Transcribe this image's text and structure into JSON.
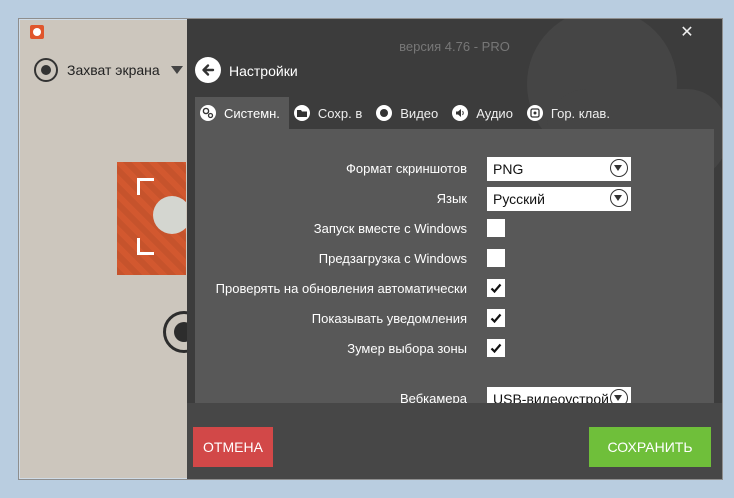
{
  "app": {
    "version": "версия 4.76 - PRO",
    "close_glyph": "✕"
  },
  "left": {
    "capture_mode": "Захват экрана"
  },
  "header": {
    "title": "Настройки"
  },
  "tabs": [
    {
      "label": "Системн.",
      "icon": "gears-icon",
      "active": true
    },
    {
      "label": "Сохр. в",
      "icon": "folder-icon",
      "active": false
    },
    {
      "label": "Видео",
      "icon": "record-icon",
      "active": false
    },
    {
      "label": "Аудио",
      "icon": "speaker-icon",
      "active": false
    },
    {
      "label": "Гор. клав.",
      "icon": "hotkey-icon",
      "active": false
    }
  ],
  "settings": {
    "screenshot_format": {
      "label": "Формат скриншотов",
      "value": "PNG"
    },
    "language": {
      "label": "Язык",
      "value": "Русский"
    },
    "start_with_windows": {
      "label": "Запуск вместе с Windows",
      "checked": false
    },
    "preload_with_windows": {
      "label": "Предзагрузка с Windows",
      "checked": false
    },
    "auto_update_check": {
      "label": "Проверять на обновления автоматически",
      "checked": true
    },
    "show_notifications": {
      "label": "Показывать уведомления",
      "checked": true
    },
    "zone_zoomer": {
      "label": "Зумер выбора зоны",
      "checked": true
    },
    "webcam": {
      "label": "Вебкамера",
      "value": "USB-видеоустрой"
    }
  },
  "footer": {
    "cancel_label": "ОТМЕНА",
    "save_label": "СОХРАНИТЬ"
  },
  "colors": {
    "cancel": "#d24848",
    "save": "#6fbf3a",
    "panel": "#3c3c3c",
    "content": "#585858",
    "brand": "#e0562c"
  }
}
